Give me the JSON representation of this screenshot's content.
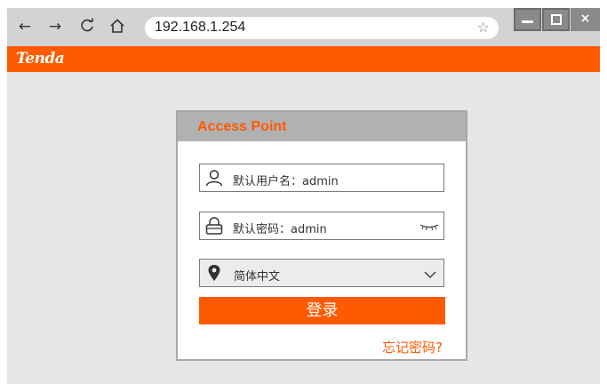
{
  "browser": {
    "url": "192.168.1.254",
    "nav_icons": [
      "back-arrow-icon",
      "forward-arrow-icon",
      "reload-icon",
      "home-icon"
    ],
    "window_controls": {
      "close_label": "×"
    }
  },
  "brand": {
    "logo_text": "Tenda",
    "color": "#ff5a00"
  },
  "login": {
    "title": "Access Point",
    "username_placeholder": "默认用户名：admin",
    "password_placeholder": "默认密码：admin",
    "language_selected": "简体中文",
    "login_button": "登录",
    "forgot_password": "忘记密码?"
  }
}
